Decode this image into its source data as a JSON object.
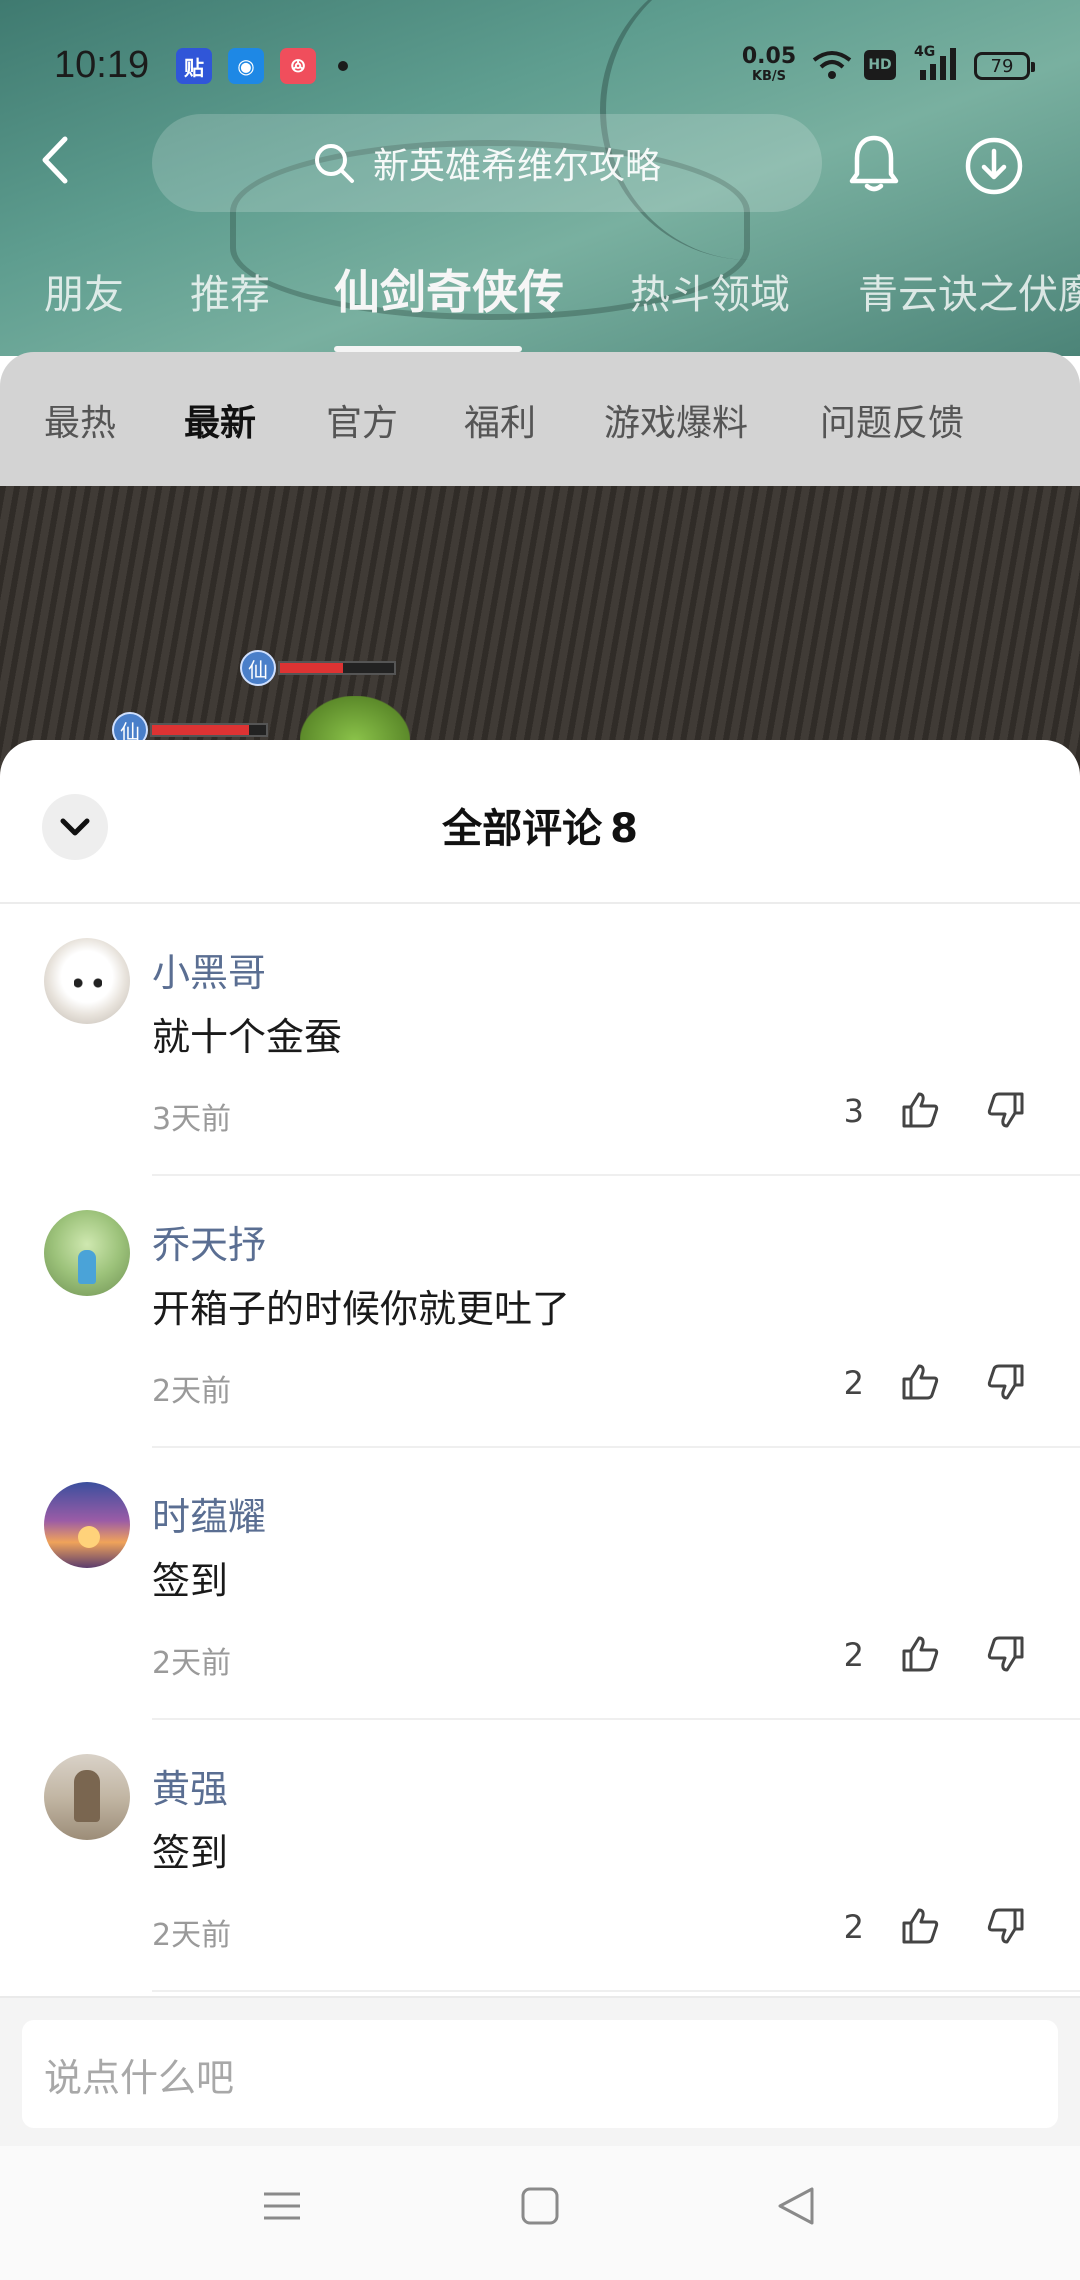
{
  "status_bar": {
    "time": "10:19",
    "notification_icons": [
      "贴",
      "◉",
      "ꔮ"
    ],
    "net_speed_value": "0.05",
    "net_speed_unit": "KB/S",
    "hd_label": "HD",
    "network_type": "4G",
    "battery_level": "79"
  },
  "top_bar": {
    "search_placeholder": "新英雄希维尔攻略"
  },
  "game_tabs": {
    "items": [
      "朋友",
      "推荐",
      "仙剑奇侠传",
      "热斗领域",
      "青云诀之伏魔"
    ],
    "active_index": 2
  },
  "sub_tabs": {
    "items": [
      "最热",
      "最新",
      "官方",
      "福利",
      "游戏爆料",
      "问题反馈"
    ],
    "active_index": 1
  },
  "video": {
    "unit_badge_text": "仙",
    "unit1_hp": 0.55,
    "unit2_hp": 0.85
  },
  "comments_sheet": {
    "title": "全部评论",
    "count": "8",
    "comments": [
      {
        "name": "小黑哥",
        "text": "就十个金蚕",
        "time": "3天前",
        "likes": "3"
      },
      {
        "name": "乔天抒",
        "text": "开箱子的时候你就更吐了",
        "time": "2天前",
        "likes": "2"
      },
      {
        "name": "时蕴耀",
        "text": "签到",
        "time": "2天前",
        "likes": "2"
      },
      {
        "name": "黄强",
        "text": "签到",
        "time": "2天前",
        "likes": "2"
      }
    ]
  },
  "input": {
    "placeholder": "说点什么吧"
  },
  "icons": {
    "back": "back-arrow-icon",
    "search": "search-icon",
    "bell": "bell-icon",
    "download": "download-icon",
    "collapse": "chevron-down-icon",
    "like": "thumbs-up-icon",
    "dislike": "thumbs-down-icon",
    "nav_menu": "menu-icon",
    "nav_home": "home-square-icon",
    "nav_back": "back-triangle-icon"
  },
  "colors": {
    "header_teal": "#5e9d8f",
    "username_blue": "#5a6e92",
    "sub_tabs_bg": "#d3d3d3"
  }
}
